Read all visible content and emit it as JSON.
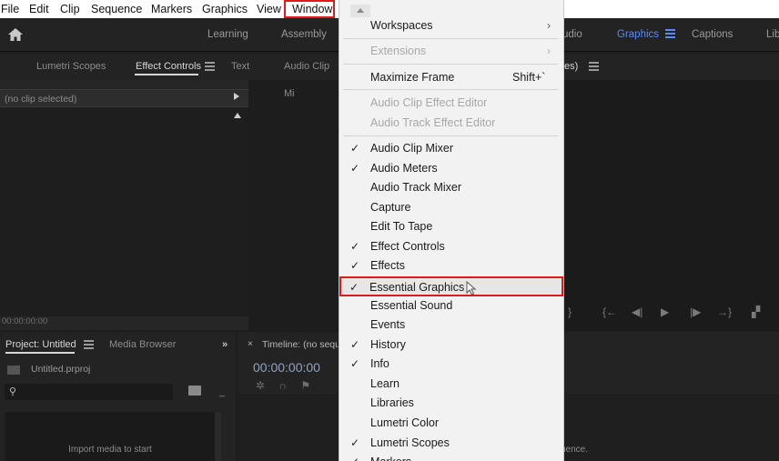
{
  "menubar": {
    "items": [
      "File",
      "Edit",
      "Clip",
      "Sequence",
      "Markers",
      "Graphics",
      "View",
      "Window"
    ]
  },
  "workspaces": {
    "tabs": [
      {
        "label": "Learning"
      },
      {
        "label": "Assembly"
      },
      {
        "label": "Audio",
        "visible": "udio"
      },
      {
        "label": "Graphics",
        "active": true
      },
      {
        "label": "Captions"
      },
      {
        "label": "Libraries",
        "visible": "Libr"
      }
    ]
  },
  "left_panel_tabs": {
    "scopes": "Lumetri Scopes",
    "effect_controls": "Effect Controls",
    "text": "Text",
    "audio_clip_mixer": "Audio Clip Mi"
  },
  "effect_controls": {
    "no_clip": "(no clip selected)",
    "timecode": "00:00:00:00"
  },
  "right_panel": {
    "tab_label_fragment": "es)"
  },
  "project": {
    "tab": "Project: Untitled",
    "media_browser": "Media Browser",
    "file_name": "Untitled.prproj",
    "import_text": "Import media to start"
  },
  "timeline": {
    "title": "Timeline: (no sequ",
    "timecode": "00:00:00:00",
    "message_fragment": "uence."
  },
  "window_menu": {
    "items": [
      {
        "label": "Workspaces",
        "submenu": true
      },
      {
        "label": "Extensions",
        "submenu": true,
        "disabled": true
      },
      {
        "label": "Maximize Frame",
        "shortcut": "Shift+`"
      },
      {
        "label": "Audio Clip Effect Editor",
        "disabled": true
      },
      {
        "label": "Audio Track Effect Editor",
        "disabled": true
      },
      {
        "label": "Audio Clip Mixer",
        "checked": true
      },
      {
        "label": "Audio Meters",
        "checked": true
      },
      {
        "label": "Audio Track Mixer"
      },
      {
        "label": "Capture"
      },
      {
        "label": "Edit To Tape"
      },
      {
        "label": "Effect Controls",
        "checked": true
      },
      {
        "label": "Effects",
        "checked": true
      },
      {
        "label": "Essential Graphics",
        "checked": true,
        "highlighted": true
      },
      {
        "label": "Essential Sound"
      },
      {
        "label": "Events"
      },
      {
        "label": "History",
        "checked": true
      },
      {
        "label": "Info",
        "checked": true
      },
      {
        "label": "Learn"
      },
      {
        "label": "Libraries"
      },
      {
        "label": "Lumetri Color"
      },
      {
        "label": "Lumetri Scopes",
        "checked": true
      },
      {
        "label": "Markers",
        "checked": true
      }
    ],
    "check_glyph": "✓",
    "submenu_glyph": "›"
  },
  "colors": {
    "accent_blue": "#5a8bf5",
    "highlight_red": "#e01a1a",
    "menu_bg": "#f2f2f2",
    "panel_bg": "#232323"
  }
}
